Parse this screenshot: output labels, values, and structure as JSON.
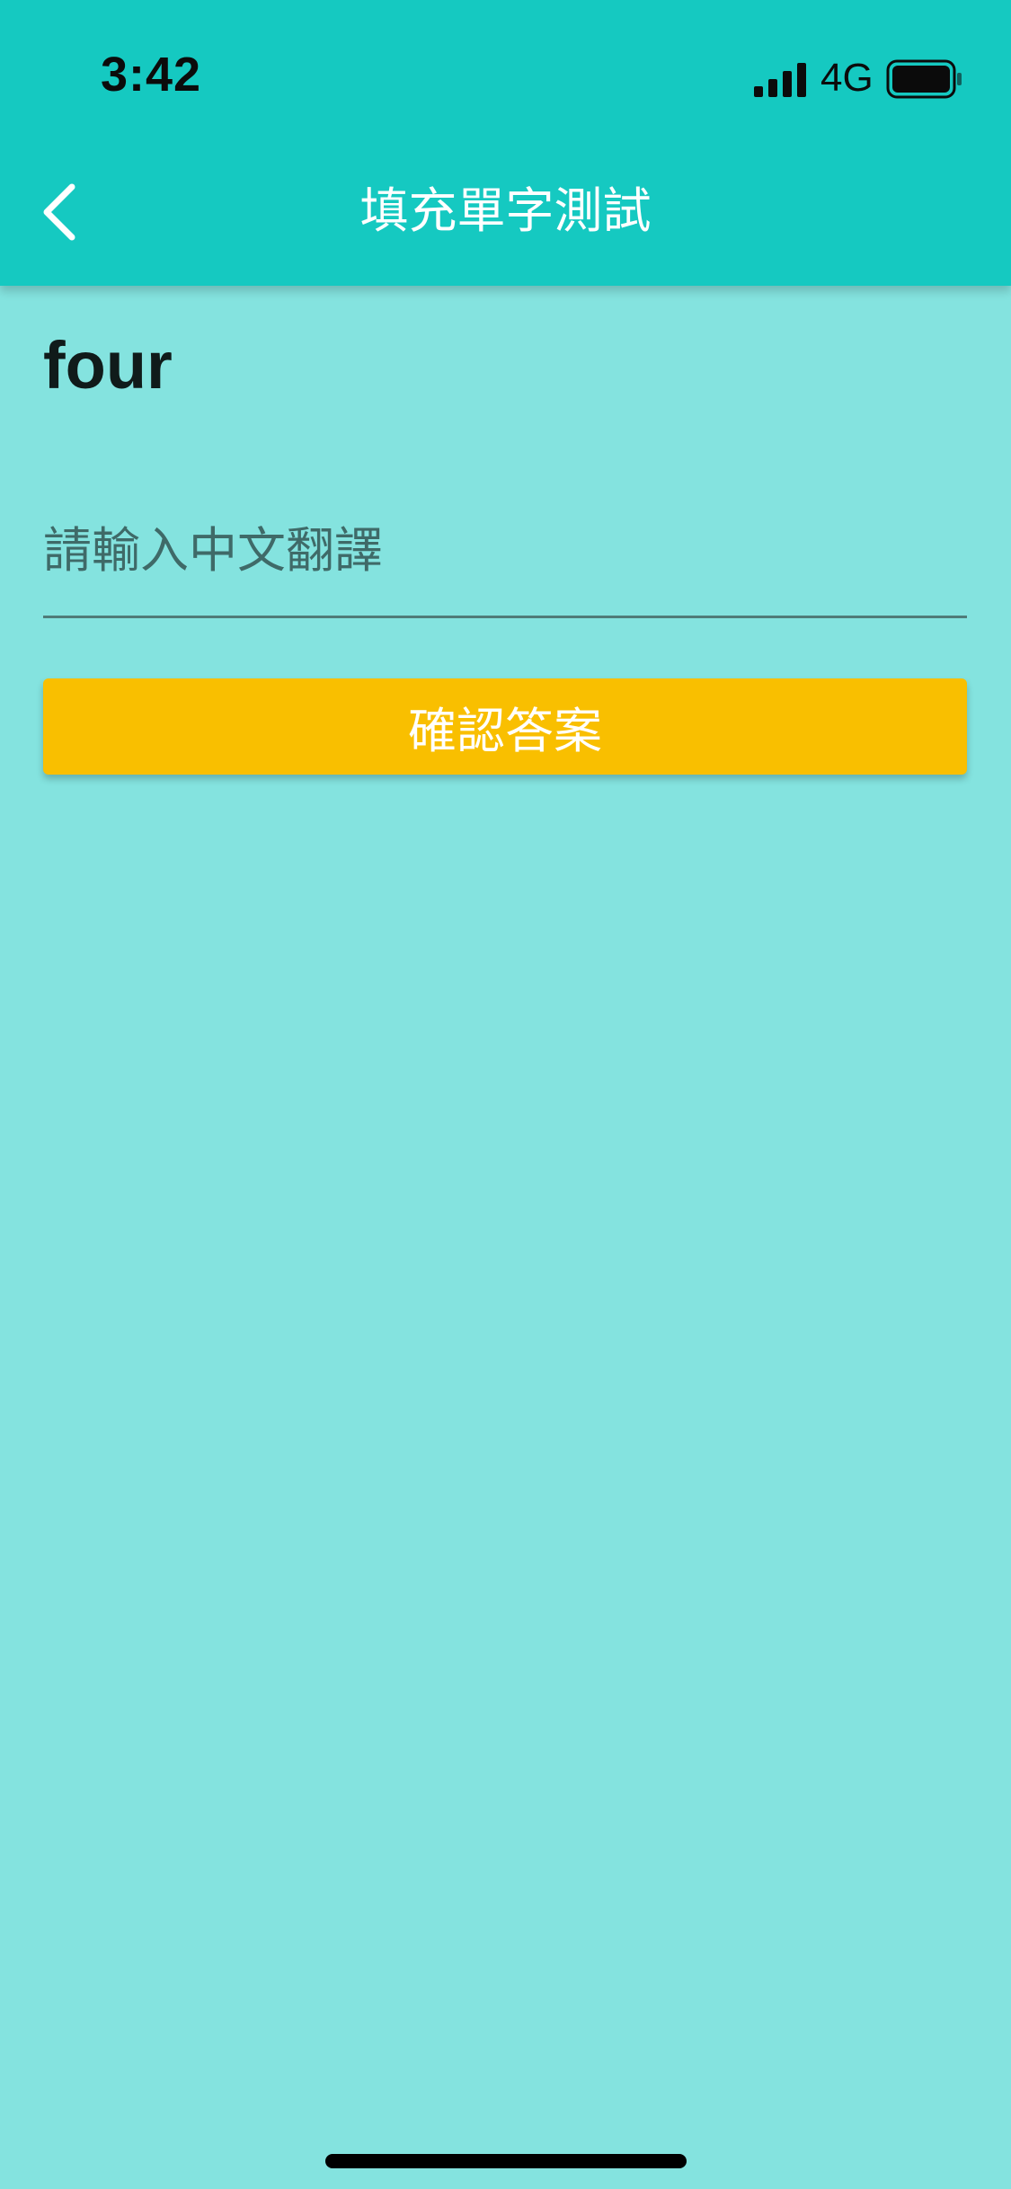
{
  "status_bar": {
    "time": "3:42",
    "network": "4G",
    "signal_icon": "cellular-signal-icon",
    "battery_icon": "battery-full-icon"
  },
  "nav": {
    "title": "填充單字測試",
    "back_icon": "chevron-left-icon"
  },
  "quiz": {
    "word": "four",
    "input_placeholder": "請輸入中文翻譯",
    "input_value": "",
    "confirm_label": "確認答案"
  },
  "colors": {
    "header": "#15C9C1",
    "background": "#84E3DF",
    "confirm_button": "#F9BF00"
  }
}
